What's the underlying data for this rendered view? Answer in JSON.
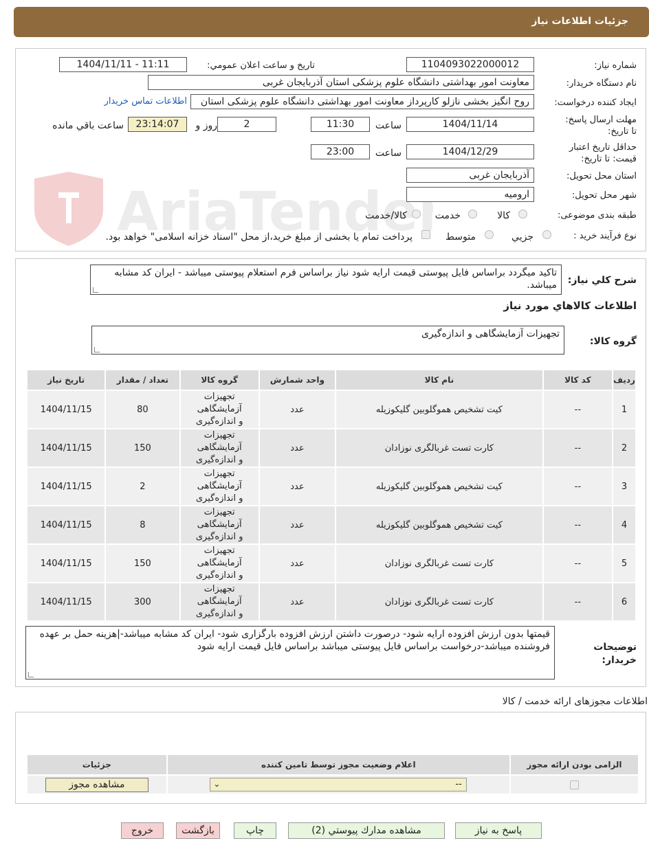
{
  "header": {
    "title": "جزئیات اطلاعات نیاز"
  },
  "watermark": {
    "text": "AriaTender.neT"
  },
  "info": {
    "need_number_label": "شماره نیاز:",
    "need_number": "1104093022000012",
    "announce_label": "تاریخ و ساعت اعلان عمومي:",
    "announce_value": "1404/11/11 - 11:11",
    "buyer_label": "نام دستگاه خریدار:",
    "buyer_value": "معاونت امور بهداشتی دانشگاه علوم پزشکی استان آذربایجان غربی",
    "creator_label": "ایجاد کننده درخواست:",
    "creator_value": "روح انگیز بخشی نازلو کارپرداز معاونت امور بهداشتی دانشگاه علوم پزشکی استان",
    "contact_link": "اطلاعات تماس خریدار",
    "deadline_label": "مهلت ارسال پاسخ: تا تاریخ:",
    "deadline_date": "1404/11/14",
    "time_label": "ساعت",
    "deadline_time": "11:30",
    "days_value": "2",
    "days_label": "روز و",
    "remaining_value": "23:14:07",
    "remaining_label": "ساعت باقي مانده",
    "validity_label": "حداقل تاریخ اعتبار قیمت: تا تاریخ:",
    "validity_date": "1404/12/29",
    "validity_time_label": "ساعت",
    "validity_time": "23:00",
    "province_label": "استان محل تحویل:",
    "province_value": "آذربایجان غربی",
    "city_label": "شهر محل تحویل:",
    "city_value": "ارومیه",
    "category_label": "طبقه بندی موضوعی:",
    "category_options": [
      "کالا",
      "خدمت",
      "کالا/خدمت"
    ],
    "process_label": "نوع فرآیند خرید :",
    "process_options": [
      "جزیي",
      "متوسط"
    ],
    "process_note": "پرداخت تمام یا بخشی از مبلغ خرید،از محل \"اسناد خزانه اسلامی\" خواهد بود."
  },
  "summary": {
    "label": "شرح کلي نیاز:",
    "text": "تاکید میگردد براساس فایل پیوستی قیمت ارایه شود نیاز براساس فرم استعلام پیوستی میباشد - ایران کد مشابه میباشد.",
    "goods_info_title": "اطلاعات کالاهاي مورد نیاز",
    "group_label": "گروه کالا:",
    "group_value": "تجهیزات آزمایشگاهی و اندازه‌گیری"
  },
  "items_table": {
    "headers": [
      "ردیف",
      "کد کالا",
      "نام کالا",
      "واحد شمارش",
      "گروه کالا",
      "تعداد / مقدار",
      "تاریخ نیاز"
    ],
    "rows": [
      [
        "1",
        "--",
        "کیت تشخیص هموگلوبین گلیکوزیله",
        "عدد",
        "تجهیزات آزمایشگاهی و اندازه‌گیری",
        "80",
        "1404/11/15"
      ],
      [
        "2",
        "--",
        "کارت تست غربالگری نوزادان",
        "عدد",
        "تجهیزات آزمایشگاهی و اندازه‌گیری",
        "150",
        "1404/11/15"
      ],
      [
        "3",
        "--",
        "کیت تشخیص هموگلوبین گلیکوزیله",
        "عدد",
        "تجهیزات آزمایشگاهی و اندازه‌گیری",
        "2",
        "1404/11/15"
      ],
      [
        "4",
        "--",
        "کیت تشخیص هموگلوبین گلیکوزیله",
        "عدد",
        "تجهیزات آزمایشگاهی و اندازه‌گیری",
        "8",
        "1404/11/15"
      ],
      [
        "5",
        "--",
        "کارت تست غربالگری نوزادان",
        "عدد",
        "تجهیزات آزمایشگاهی و اندازه‌گیری",
        "150",
        "1404/11/15"
      ],
      [
        "6",
        "--",
        "کارت تست غربالگری نوزادان",
        "عدد",
        "تجهیزات آزمایشگاهی و اندازه‌گیری",
        "300",
        "1404/11/15"
      ]
    ]
  },
  "buyer_notes": {
    "label": "توضیحات خریدار:",
    "text": "قیمتها بدون ارزش افزوده ارایه شود- درصورت داشتن ارزش افزوده بارگزاری شود- ایران کد مشابه میباشد-|هزینه حمل بر عهده فروشنده میباشد-درخواست براساس فایل پیوستی میباشد براساس فایل قیمت ارایه شود"
  },
  "permits": {
    "title": "اطلاعات مجوزهای ارائه خدمت / کالا",
    "headers": [
      "الزامی بودن ارائه مجوز",
      "اعلام وضعیت مجوز توسط تامین کننده",
      "جزئیات"
    ],
    "select_value": "--",
    "view_button": "مشاهده مجوز"
  },
  "buttons": {
    "reply": "پاسخ به نیاز",
    "attachments": "مشاهده مدارك پيوستي (2)",
    "print": "چاپ",
    "back": "بازگشت",
    "exit": "خروج"
  }
}
